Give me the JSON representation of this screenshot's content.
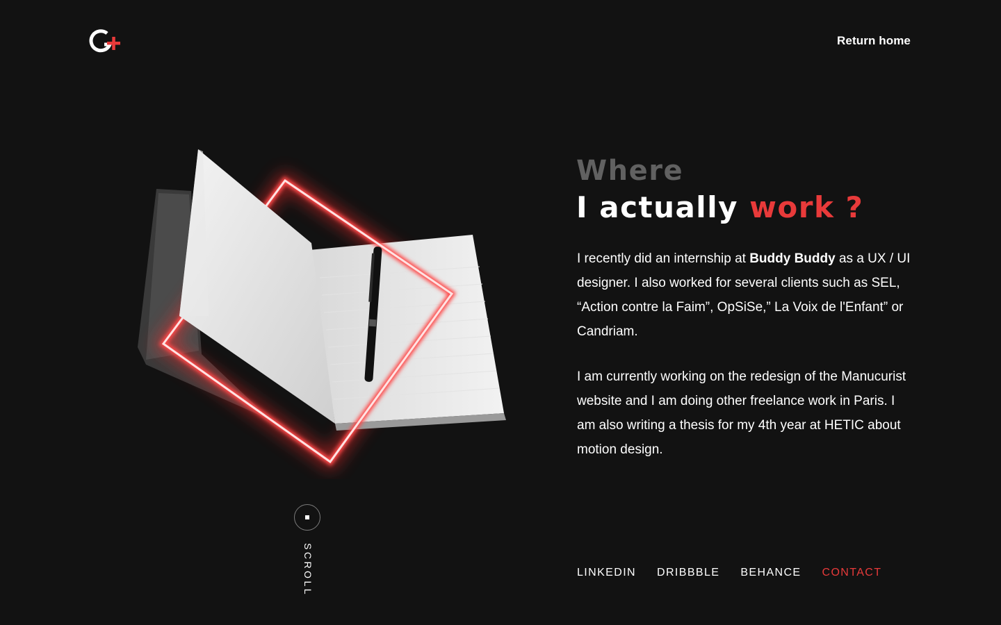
{
  "header": {
    "logo_text": "G+",
    "return_home_label": "Return home"
  },
  "title": {
    "line1": "Where",
    "line2_pre": "I actually",
    "line2_accent": "work ?"
  },
  "paragraph1": {
    "part1": "I recently did an internship at ",
    "company": "Buddy Buddy",
    "part2": " as a UX / UI designer. I also worked for several clients such as SEL, “Action contre la Faim”, OpSiSe,” La Voix de l'Enfant” or Candriam."
  },
  "paragraph2": "I am currently working on the redesign of the Manucurist website and I am doing other freelance work in Paris. I am also writing a thesis for my 4th year at HETIC about motion design.",
  "social": {
    "linkedin": "LINKEDIN",
    "dribbble": "DRIBBBLE",
    "behance": "BEHANCE",
    "contact": "CONTACT"
  },
  "scroll": {
    "label": "SCROLL"
  },
  "colors": {
    "background": "#121212",
    "accent": "#e83a3a",
    "muted_title": "#616161",
    "text": "#ffffff"
  },
  "icons": {
    "logo": "g-plus-logo-icon",
    "hero": "notebook-neon-frame-illustration",
    "scroll": "scroll-indicator-icon"
  }
}
